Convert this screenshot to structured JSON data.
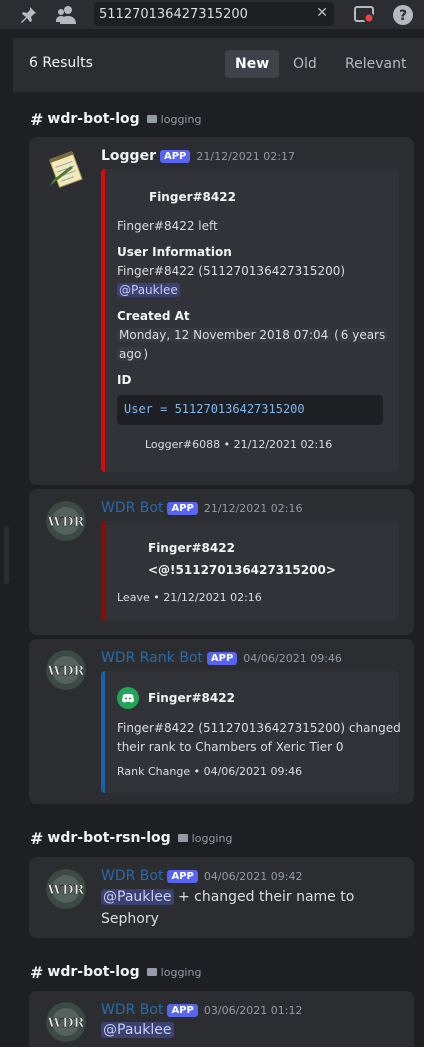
{
  "toolbar": {
    "icons": [
      "pin-icon",
      "members-icon",
      "inbox-icon",
      "help-icon"
    ],
    "search_value": "511270136427315200"
  },
  "results": {
    "count_label": "6 Results",
    "sort_options": [
      "New",
      "Old",
      "Relevant"
    ],
    "active_sort": "New"
  },
  "groups": [
    {
      "channel": "wdr-bot-log",
      "category": "logging"
    },
    {
      "channel": "wdr-bot-rsn-log",
      "category": "logging"
    },
    {
      "channel": "wdr-bot-log",
      "category": "logging"
    }
  ],
  "messages": [
    {
      "author": "Logger",
      "badge": "APP",
      "timestamp": "21/12/2021 02:17",
      "author_color": "#f2f3f5",
      "embed": {
        "bar_color": "#da0b0b",
        "title": "Finger#8422",
        "description": "Finger#8422 left",
        "field1_name": "User Information",
        "field1_value": "Finger#8422 (511270136427315200)",
        "field1_mention": "@Pauklee",
        "field2_name": "Created At",
        "field2_date": "Monday, 12 November 2018 07:04",
        "field2_rel_a": "6 years",
        "field2_rel_b": "ago",
        "field3_name": "ID",
        "code": "User = 511270136427315200",
        "footer": "Logger#6088 • 21/12/2021 02:16"
      }
    },
    {
      "author": "WDR Bot",
      "badge": "APP",
      "timestamp": "21/12/2021 02:16",
      "author_color": "#2c6aa8",
      "embed": {
        "bar_color": "#8b0b0b",
        "line1": "Finger#8422",
        "line2": "<@!511270136427315200>",
        "footer": "Leave • 21/12/2021 02:16"
      }
    },
    {
      "author": "WDR Rank Bot",
      "badge": "APP",
      "timestamp": "04/06/2021 09:46",
      "author_color": "#2c6aa8",
      "embed": {
        "bar_color": "#1f5fa8",
        "title": "Finger#8422",
        "desc_line1": "Finger#8422 (511270136427315200) changed",
        "desc_line2": "their rank to Chambers of Xeric Tier 0",
        "footer": "Rank Change • 04/06/2021 09:46"
      }
    },
    {
      "author": "WDR Bot",
      "badge": "APP",
      "timestamp": "04/06/2021 09:42",
      "author_color": "#2c6aa8",
      "mention": "@Pauklee",
      "text_a": "+ changed their name to",
      "text_b": "Sephory"
    },
    {
      "author": "WDR Bot",
      "badge": "APP",
      "timestamp": "03/06/2021 01:12",
      "author_color": "#2c6aa8",
      "mention": "@Pauklee"
    }
  ]
}
